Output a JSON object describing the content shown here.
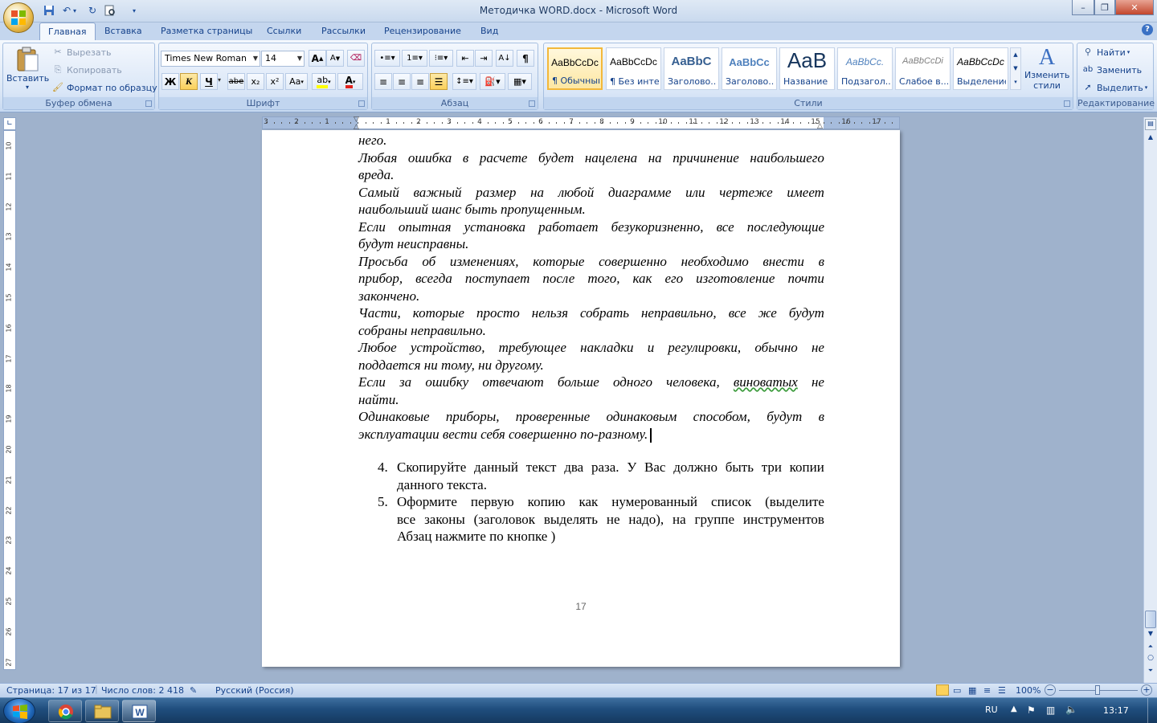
{
  "window": {
    "title": "Методичка WORD.docx - Microsoft Word",
    "minimize": "–",
    "maximize": "❐",
    "close": "✕"
  },
  "qat": [
    "save-icon",
    "undo-icon",
    "redo-icon",
    "print-preview-icon",
    "customize-icon"
  ],
  "tabs": [
    {
      "label": "Главная",
      "active": true
    },
    {
      "label": "Вставка"
    },
    {
      "label": "Разметка страницы"
    },
    {
      "label": "Ссылки"
    },
    {
      "label": "Рассылки"
    },
    {
      "label": "Рецензирование"
    },
    {
      "label": "Вид"
    }
  ],
  "clipboard": {
    "paste": "Вставить",
    "cut": "Вырезать",
    "copy": "Копировать",
    "format_painter": "Формат по образцу",
    "label": "Буфер обмена"
  },
  "font": {
    "name": "Times New Roman",
    "size": "14",
    "label": "Шрифт",
    "bold": "Ж",
    "italic": "К",
    "underline": "Ч",
    "strike": "abe",
    "subscript": "x₂",
    "superscript": "x²",
    "case": "Aa",
    "grow": "A",
    "shrink": "A"
  },
  "paragraph": {
    "label": "Абзац"
  },
  "styles": {
    "label": "Стили",
    "items": [
      {
        "preview": "AaBbCcDc",
        "name": "¶ Обычный",
        "selected": true
      },
      {
        "preview": "AaBbCcDc",
        "name": "¶ Без инте..."
      },
      {
        "preview": "AaBbC",
        "name": "Заголово..."
      },
      {
        "preview": "AaBbCc",
        "name": "Заголово..."
      },
      {
        "preview": "AaB",
        "name": "Название"
      },
      {
        "preview": "AaBbCc.",
        "name": "Подзагол..."
      },
      {
        "preview": "AaBbCcDi",
        "name": "Слабое в..."
      },
      {
        "preview": "AaBbCcDc",
        "name": "Выделение"
      }
    ],
    "change": "Изменить стили"
  },
  "editing": {
    "label": "Редактирование",
    "find": "Найти",
    "replace": "Заменить",
    "select": "Выделить"
  },
  "ruler": {
    "h_ticks": [
      "3",
      "2",
      "1",
      "1",
      "2",
      "3",
      "4",
      "5",
      "6",
      "7",
      "8",
      "9",
      "10",
      "11",
      "12",
      "13",
      "14",
      "15",
      "16",
      "17"
    ],
    "v_ticks": [
      "10",
      "11",
      "12",
      "13",
      "14",
      "15",
      "16",
      "17",
      "18",
      "19",
      "20",
      "21",
      "22",
      "23",
      "24",
      "25",
      "26",
      "27"
    ]
  },
  "document": {
    "italic_lines": [
      [
        "него."
      ],
      [
        "Любая",
        "ошибка",
        "в",
        "расчете",
        "будет",
        "нацелена",
        "на",
        "причинение",
        "наибольшего"
      ],
      [
        "вреда."
      ],
      [
        "Самый",
        "важный",
        "размер",
        "на",
        "любой",
        "диаграмме",
        "или",
        "чертеже",
        "имеет"
      ],
      [
        "наибольший шанс быть пропущенным."
      ],
      [
        "Если",
        "опытная",
        "установка",
        "работает",
        "безукоризненно,",
        "все",
        "последующие"
      ],
      [
        "будут неисправны."
      ],
      [
        "Просьба",
        "об",
        "изменениях,",
        "которые",
        "совершенно",
        "необходимо",
        "внести",
        "в"
      ],
      [
        "прибор,",
        "всегда",
        "поступает",
        "после",
        "того,",
        "как",
        "его",
        "изготовление",
        "почти"
      ],
      [
        "закончено."
      ],
      [
        "Части,",
        "которые",
        "просто",
        "нельзя",
        "собрать",
        "неправильно,",
        "все",
        "же",
        "будут"
      ],
      [
        "собраны неправильно."
      ],
      [
        "Любое",
        "устройство,",
        "требующее",
        "накладки",
        "и",
        "регулировки,",
        "обычно",
        "не"
      ],
      [
        "поддается ни тому, ни другому."
      ],
      [
        "Если",
        "за",
        "ошибку",
        "отвечают",
        "больше",
        "одного",
        "человека,",
        "виноватых",
        "не"
      ],
      [
        "найти."
      ],
      [
        "Одинаковые",
        "приборы,",
        "проверенные",
        "одинаковым",
        "способом,",
        "будут",
        "в"
      ],
      [
        "эксплуатации вести себя совершенно по-разному."
      ]
    ],
    "list": [
      {
        "num": "4.",
        "lines": [
          [
            "Скопируйте",
            "данный",
            "текст",
            "два",
            "раза.",
            "У",
            "Вас",
            "должно",
            "быть",
            "три",
            "копии"
          ],
          [
            "данного текста."
          ]
        ]
      },
      {
        "num": "5.",
        "lines": [
          [
            "Оформите",
            "первую",
            "копию",
            "как",
            "нумерованный",
            "список",
            "(выделите"
          ],
          [
            "все",
            "законы",
            "(заголовок",
            "выделять",
            "не",
            "надо),",
            "на",
            "группе",
            "инструментов"
          ],
          [
            "Абзац нажмите по кнопке )"
          ]
        ]
      }
    ],
    "page_number": "17"
  },
  "status": {
    "page": "Страница: 17 из 17",
    "words": "Число слов: 2 418",
    "language": "Русский (Россия)",
    "zoom": "100%"
  },
  "taskbar": {
    "lang": "RU",
    "time": "13:17",
    "apps": [
      "chrome-icon",
      "explorer-icon",
      "word-icon"
    ]
  }
}
